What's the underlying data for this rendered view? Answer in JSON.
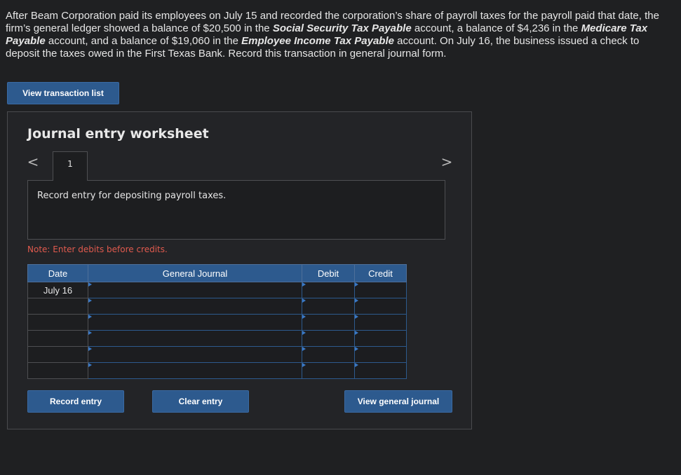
{
  "problem": {
    "p1": "After Beam Corporation paid its employees on July 15 and recorded the corporation’s share of payroll taxes for the payroll paid that date, the firm’s general ledger showed a balance of $20,500 in the ",
    "acct1": "Social Security Tax Payable",
    "p2": " account, a balance of $4,236 in the ",
    "acct2": "Medicare Tax Payable",
    "p3": " account, and a balance of $19,060 in the ",
    "acct3": "Employee Income Tax Payable",
    "p4": " account. On July 16, the business issued a check to deposit the taxes owed in the First Texas Bank. Record this transaction in general journal form."
  },
  "buttons": {
    "view_transaction_list": "View transaction list",
    "record_entry": "Record entry",
    "clear_entry": "Clear entry",
    "view_general_journal": "View general journal"
  },
  "worksheet": {
    "title": "Journal entry worksheet",
    "tab_number": "1",
    "prev_arrow": "<",
    "next_arrow": ">",
    "description": "Record entry for depositing payroll taxes.",
    "note": "Note: Enter debits before credits."
  },
  "journal": {
    "headers": {
      "date": "Date",
      "account": "General Journal",
      "debit": "Debit",
      "credit": "Credit"
    },
    "rows": [
      {
        "date": "July 16",
        "account": "",
        "debit": "",
        "credit": ""
      },
      {
        "date": "",
        "account": "",
        "debit": "",
        "credit": ""
      },
      {
        "date": "",
        "account": "",
        "debit": "",
        "credit": ""
      },
      {
        "date": "",
        "account": "",
        "debit": "",
        "credit": ""
      },
      {
        "date": "",
        "account": "",
        "debit": "",
        "credit": ""
      },
      {
        "date": "",
        "account": "",
        "debit": "",
        "credit": ""
      }
    ]
  },
  "colors": {
    "accent": "#2d5a8e",
    "note": "#e05a4e",
    "background": "#1f2022"
  }
}
